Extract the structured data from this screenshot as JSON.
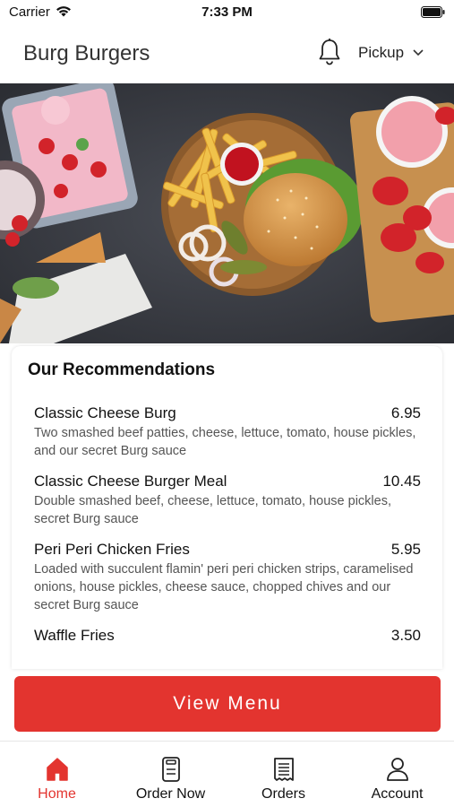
{
  "status_bar": {
    "carrier": "Carrier",
    "time": "7:33 PM"
  },
  "header": {
    "title": "Burg Burgers",
    "order_mode": "Pickup"
  },
  "recommendations": {
    "title": "Our Recommendations",
    "items": [
      {
        "name": "Classic Cheese Burg",
        "price": "6.95",
        "description": "Two smashed beef patties, cheese, lettuce, tomato, house pickles, and our secret Burg sauce"
      },
      {
        "name": "Classic Cheese Burger Meal",
        "price": "10.45",
        "description": "Double smashed beef, cheese, lettuce, tomato, house pickles, secret Burg sauce"
      },
      {
        "name": "Peri Peri Chicken Fries",
        "price": "5.95",
        "description": "Loaded with succulent flamin' peri peri chicken strips, caramelised onions, house pickles, cheese sauce, chopped chives and our secret Burg sauce"
      },
      {
        "name": "Waffle Fries",
        "price": "3.50",
        "description": ""
      }
    ]
  },
  "view_menu_label": "View Menu",
  "tabs": [
    {
      "label": "Home",
      "icon": "home-icon",
      "active": true
    },
    {
      "label": "Order Now",
      "icon": "order-icon",
      "active": false
    },
    {
      "label": "Orders",
      "icon": "receipt-icon",
      "active": false
    },
    {
      "label": "Account",
      "icon": "user-icon",
      "active": false
    }
  ],
  "colors": {
    "accent": "#e3342f",
    "text": "#111111",
    "muted": "#555555"
  }
}
